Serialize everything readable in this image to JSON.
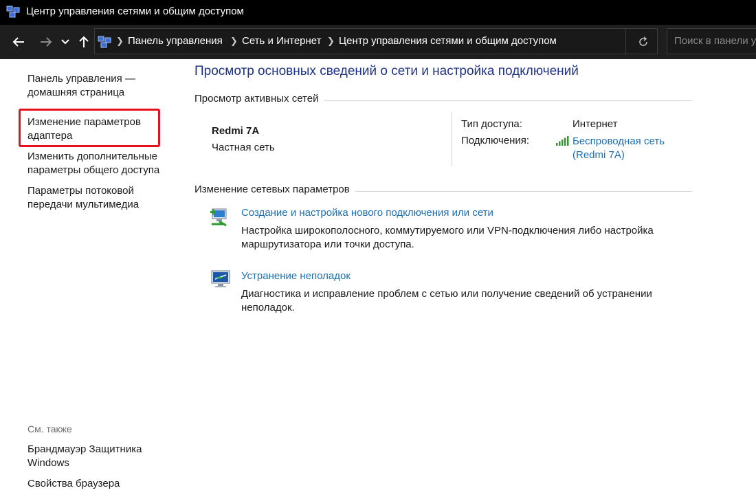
{
  "window": {
    "title": "Центр управления сетями и общим доступом"
  },
  "nav": {
    "breadcrumbs": [
      "Панель управления",
      "Сеть и Интернет",
      "Центр управления сетями и общим доступом"
    ],
    "search_placeholder": "Поиск в панели у"
  },
  "sidebar": {
    "home_link": "Панель управления — домашняя страница",
    "home_line1": "Панель управления —",
    "home_line2": "домашняя страница",
    "adapter_line1": "Изменение параметров",
    "adapter_line2": "адаптера",
    "sharing_line1": "Изменить дополнительные",
    "sharing_line2": "параметры общего доступа",
    "streaming_line1": "Параметры потоковой",
    "streaming_line2": "передачи мультимедиа",
    "see_also": "См. также",
    "firewall_line1": "Брандмауэр Защитника",
    "firewall_line2": "Windows",
    "browser_props": "Свойства браузера"
  },
  "main": {
    "title": "Просмотр основных сведений о сети и настройка подключений",
    "active_networks_header": "Просмотр активных сетей",
    "network": {
      "name": "Redmi 7A",
      "category": "Частная сеть",
      "access_type_label": "Тип доступа:",
      "access_type_value": "Интернет",
      "connections_label": "Подключения:",
      "connection_line1": "Беспроводная сеть",
      "connection_line2": "(Redmi 7A)"
    },
    "change_settings_header": "Изменение сетевых параметров",
    "tasks": [
      {
        "link": "Создание и настройка нового подключения или сети",
        "desc_line1": "Настройка широкополосного, коммутируемого или VPN-подключения либо настройка",
        "desc_line2": "маршрутизатора или точки доступа."
      },
      {
        "link": "Устранение неполадок",
        "desc_line1": "Диагностика и исправление проблем с сетью или получение сведений об устранении",
        "desc_line2": "неполадок."
      }
    ]
  },
  "colors": {
    "title_blue": "#1e3287",
    "link_blue": "#1a6fb4",
    "highlight_red": "#e8101e",
    "signal_green": "#2e9b2e"
  }
}
